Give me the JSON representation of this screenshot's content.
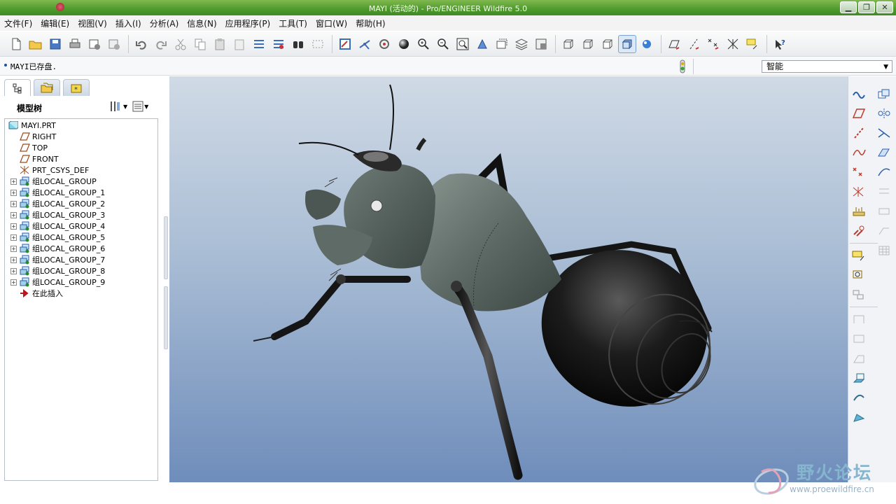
{
  "window": {
    "title": "MAYI (活动的) - Pro/ENGINEER Wildfire 5.0",
    "min_label": "▁",
    "max_label": "❐",
    "close_label": "✕"
  },
  "menu": [
    "文件(F)",
    "编辑(E)",
    "视图(V)",
    "插入(I)",
    "分析(A)",
    "信息(N)",
    "应用程序(P)",
    "工具(T)",
    "窗口(W)",
    "帮助(H)"
  ],
  "message": {
    "text": "MAYI已存盘."
  },
  "filter": {
    "value": "智能"
  },
  "navigator": {
    "title": "模型树",
    "tree": [
      {
        "label": "MAYI.PRT",
        "icon": "part-icon",
        "level": 0,
        "expandable": false
      },
      {
        "label": "RIGHT",
        "icon": "datum-plane-icon",
        "level": 1,
        "expandable": false
      },
      {
        "label": "TOP",
        "icon": "datum-plane-icon",
        "level": 1,
        "expandable": false
      },
      {
        "label": "FRONT",
        "icon": "datum-plane-icon",
        "level": 1,
        "expandable": false
      },
      {
        "label": "PRT_CSYS_DEF",
        "icon": "csys-icon",
        "level": 1,
        "expandable": false
      },
      {
        "label": "组LOCAL_GROUP",
        "icon": "group-icon",
        "level": 1,
        "expandable": true
      },
      {
        "label": "组LOCAL_GROUP_1",
        "icon": "group-icon",
        "level": 1,
        "expandable": true
      },
      {
        "label": "组LOCAL_GROUP_2",
        "icon": "group-icon",
        "level": 1,
        "expandable": true
      },
      {
        "label": "组LOCAL_GROUP_3",
        "icon": "group-icon",
        "level": 1,
        "expandable": true
      },
      {
        "label": "组LOCAL_GROUP_4",
        "icon": "group-icon",
        "level": 1,
        "expandable": true
      },
      {
        "label": "组LOCAL_GROUP_5",
        "icon": "group-icon",
        "level": 1,
        "expandable": true
      },
      {
        "label": "组LOCAL_GROUP_6",
        "icon": "group-icon",
        "level": 1,
        "expandable": true
      },
      {
        "label": "组LOCAL_GROUP_7",
        "icon": "group-icon",
        "level": 1,
        "expandable": true
      },
      {
        "label": "组LOCAL_GROUP_8",
        "icon": "group-icon",
        "level": 1,
        "expandable": true
      },
      {
        "label": "组LOCAL_GROUP_9",
        "icon": "group-icon",
        "level": 1,
        "expandable": true
      },
      {
        "label": "在此插入",
        "icon": "insert-here-arrow-icon",
        "level": 1,
        "expandable": false
      }
    ]
  },
  "watermark": {
    "text": "野火论坛",
    "url": "www.proewildfire.cn"
  },
  "colors": {
    "titlebar": "#4e9a2c",
    "viewport_top": "#d0dae6",
    "viewport_bottom": "#6f8dbb"
  }
}
